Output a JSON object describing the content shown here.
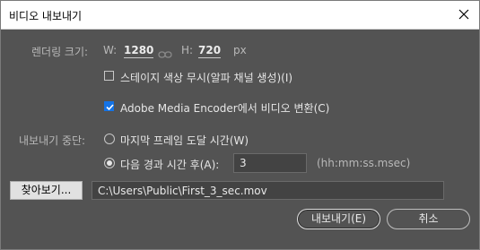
{
  "window": {
    "title": "비디오 내보내기"
  },
  "render_size": {
    "label": "렌더링 크기:",
    "width_label": "W:",
    "width_value": "1280",
    "height_label": "H:",
    "height_value": "720",
    "unit": "px"
  },
  "options": {
    "ignore_stage_color": {
      "label": "스테이지 색상 무시(알파 채널 생성)(I)",
      "checked": false
    },
    "convert_media_encoder": {
      "label": "Adobe Media Encoder에서 비디오 변환(C)",
      "checked": true
    }
  },
  "stop_export": {
    "label": "내보내기 중단:",
    "option_last_frame": {
      "label": "마지막 프레임 도달 시간(W)",
      "selected": false
    },
    "option_elapsed": {
      "label": "다음 경과 시간 후(A):",
      "selected": true,
      "value": "3",
      "hint": "(hh:mm:ss.msec)"
    }
  },
  "browse": {
    "button_label": "찾아보기...",
    "path": "C:\\Users\\Public\\First_3_sec.mov"
  },
  "buttons": {
    "export": "내보내기(E)",
    "cancel": "취소"
  },
  "colors": {
    "background": "#535353",
    "accent": "#1473e6"
  }
}
